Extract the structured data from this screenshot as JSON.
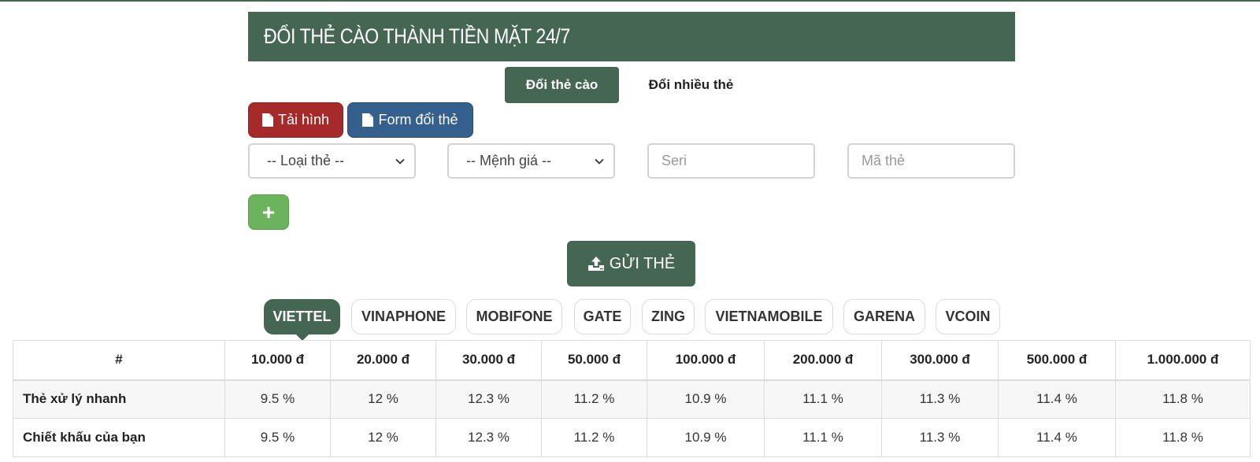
{
  "header": {
    "title": "ĐỔI THẺ CÀO THÀNH TIỀN MẶT 24/7"
  },
  "mode_tabs": [
    {
      "label": "Đổi thẻ cào",
      "active": true
    },
    {
      "label": "Đổi nhiều thẻ",
      "active": false
    }
  ],
  "actions": {
    "upload_image_label": "Tải hình",
    "form_label": "Form đổi thẻ"
  },
  "form": {
    "card_type": {
      "selected": "-- Loại thẻ --"
    },
    "card_value": {
      "selected": "-- Mệnh giá --"
    },
    "serial": {
      "value": "",
      "placeholder": "Seri"
    },
    "code": {
      "value": "",
      "placeholder": "Mã thẻ"
    },
    "add_label": "+",
    "submit_label": "GỬI THẺ"
  },
  "networks": [
    {
      "label": "VIETTEL",
      "active": true
    },
    {
      "label": "VINAPHONE",
      "active": false
    },
    {
      "label": "MOBIFONE",
      "active": false
    },
    {
      "label": "GATE",
      "active": false
    },
    {
      "label": "ZING",
      "active": false
    },
    {
      "label": "VIETNAMOBILE",
      "active": false
    },
    {
      "label": "GARENA",
      "active": false
    },
    {
      "label": "VCOIN",
      "active": false
    }
  ],
  "rate_table": {
    "headers": [
      "#",
      "10.000 đ",
      "20.000 đ",
      "30.000 đ",
      "50.000 đ",
      "100.000 đ",
      "200.000 đ",
      "300.000 đ",
      "500.000 đ",
      "1.000.000 đ"
    ],
    "rows": [
      [
        "Thẻ xử lý nhanh",
        "9.5 %",
        "12 %",
        "12.3 %",
        "11.2 %",
        "10.9 %",
        "11.1 %",
        "11.3 %",
        "11.4 %",
        "11.8 %"
      ],
      [
        "Chiết khấu của bạn",
        "9.5 %",
        "12 %",
        "12.3 %",
        "11.2 %",
        "10.9 %",
        "11.1 %",
        "11.3 %",
        "11.4 %",
        "11.8 %"
      ]
    ]
  },
  "colors": {
    "primary_green": "#456652",
    "danger_red": "#a62a2a",
    "info_blue": "#355f8c",
    "success_green": "#6cb35d"
  }
}
